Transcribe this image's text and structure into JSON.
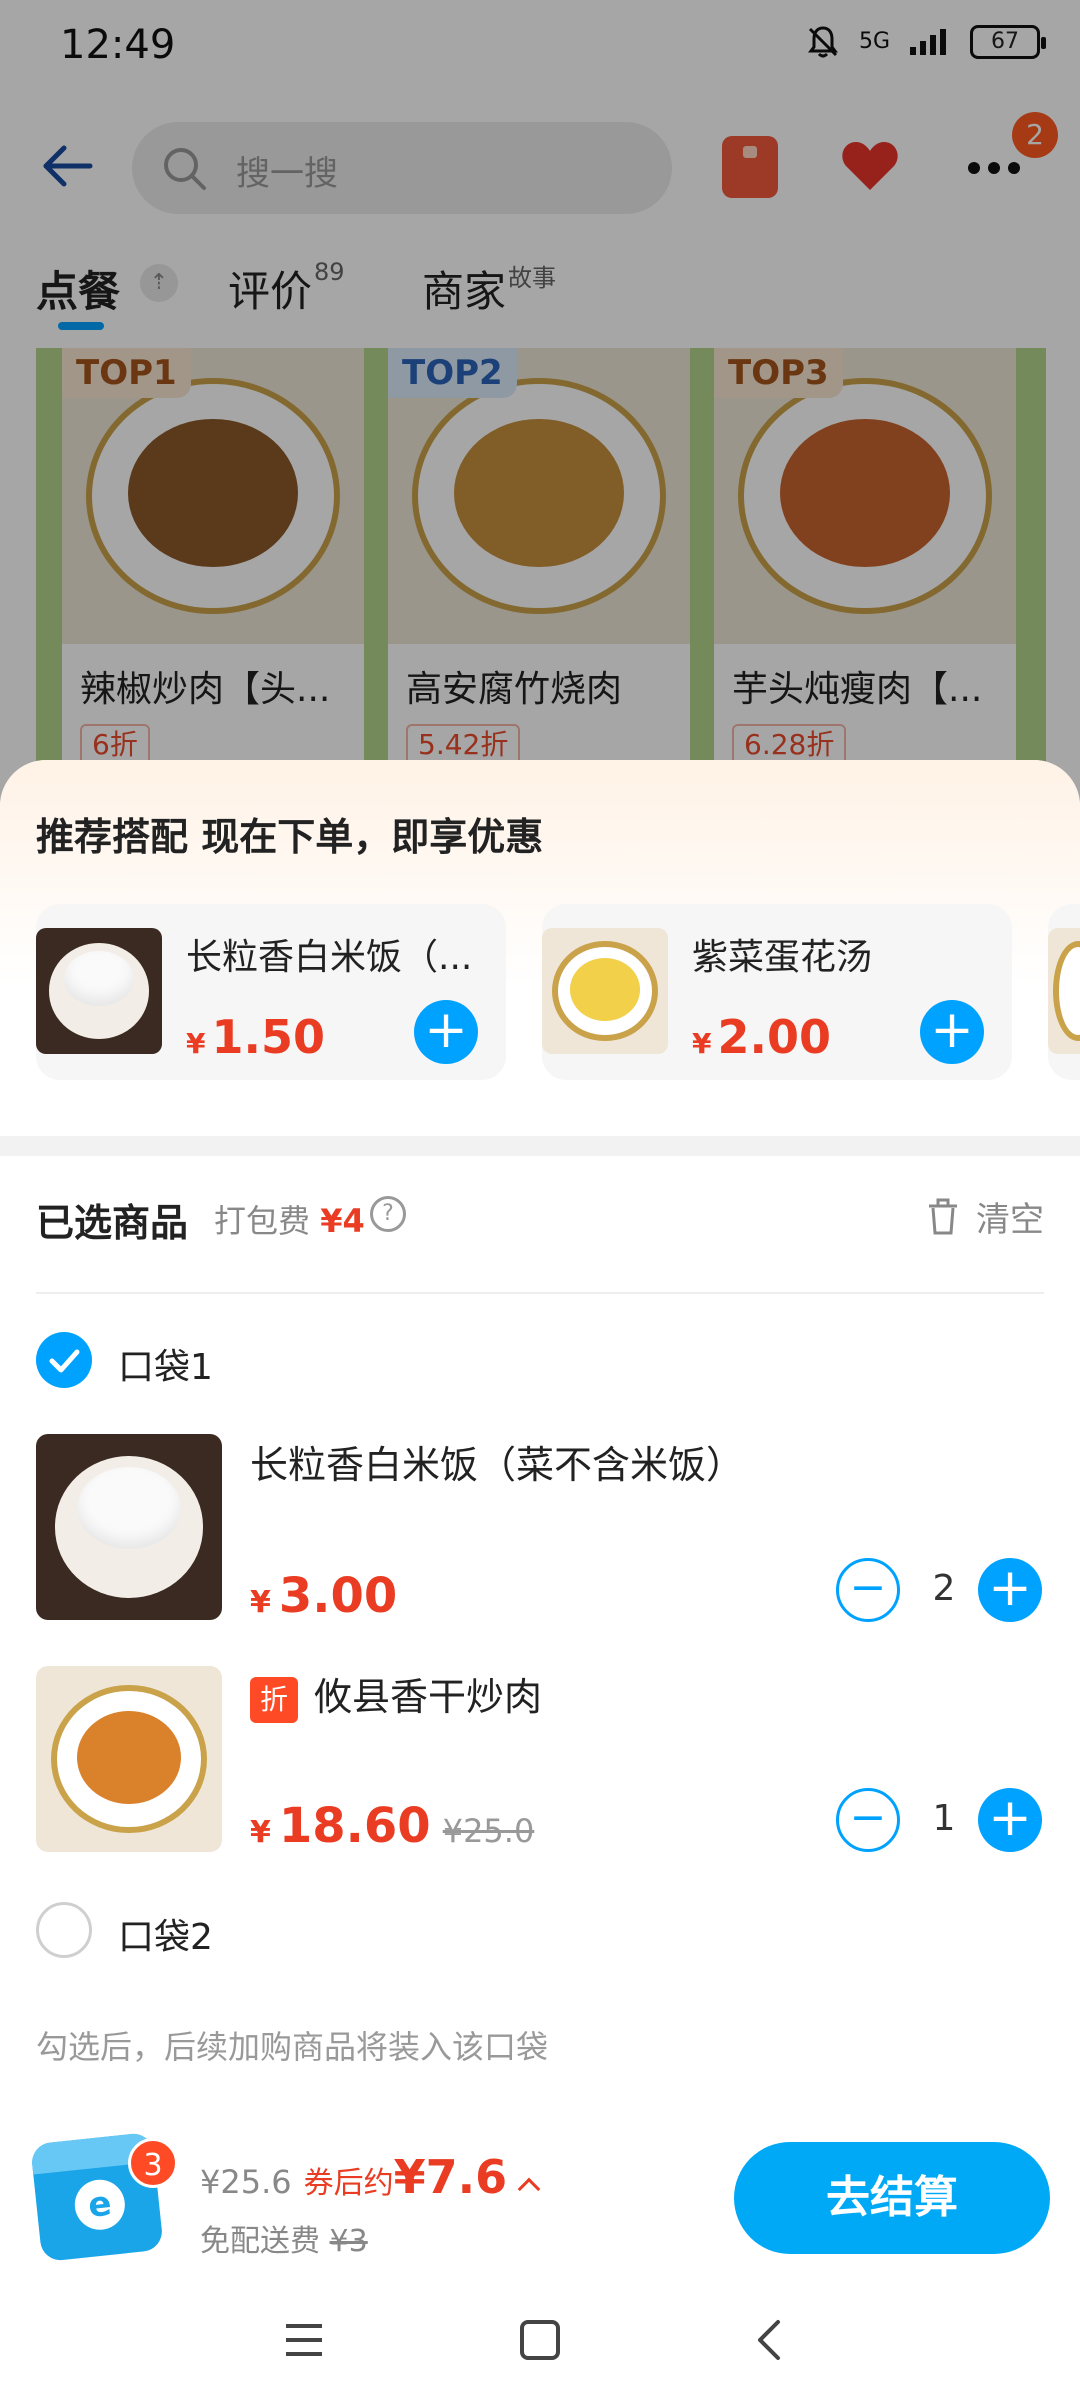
{
  "status_bar": {
    "time": "12:49",
    "signal": "5G",
    "battery": "67"
  },
  "header": {
    "search_placeholder": "搜一搜",
    "more_badge": "2"
  },
  "tabs": [
    {
      "label": "点餐",
      "sup": ""
    },
    {
      "label": "评价",
      "sup": "89"
    },
    {
      "label": "商家",
      "sup": "故事"
    }
  ],
  "top_list": [
    {
      "tag": "TOP1",
      "name": "辣椒炒肉【头...",
      "discount": "6折"
    },
    {
      "tag": "TOP2",
      "name": "高安腐竹烧肉",
      "discount": "5.42折"
    },
    {
      "tag": "TOP3",
      "name": "芋头炖瘦肉【...",
      "discount": "6.28折"
    }
  ],
  "recommend": {
    "title": "推荐搭配  现在下单，即享优惠",
    "items": [
      {
        "name": "长粒香白米饭（...",
        "currency": "¥",
        "price": "1.50"
      },
      {
        "name": "紫菜蛋花汤",
        "currency": "¥",
        "price": "2.00"
      }
    ]
  },
  "selected": {
    "title": "已选商品",
    "pack_fee_label": "打包费",
    "pack_fee": "¥4",
    "help": "?",
    "clear_label": "清空"
  },
  "bags": [
    {
      "label": "口袋1",
      "checked": true,
      "items": [
        {
          "name": "长粒香白米饭（菜不含米饭）",
          "currency": "¥",
          "price": "3.00",
          "original": "",
          "discount_tag": "",
          "qty": "2"
        },
        {
          "name": "攸县香干炒肉",
          "currency": "¥",
          "price": "18.60",
          "original": "¥25.0",
          "discount_tag": "折",
          "qty": "1"
        }
      ]
    },
    {
      "label": "口袋2",
      "checked": false,
      "items": []
    }
  ],
  "hint": "勾选后，后续加购商品将装入该口袋",
  "cart": {
    "badge": "3",
    "original_total": "¥25.6",
    "after_coupon_label": "券后约",
    "after_coupon_price": "¥7.6",
    "free_delivery_label": "免配送费",
    "delivery_original": "¥3",
    "checkout_label": "去结算"
  },
  "colors": {
    "accent": "#00a2ff",
    "price": "#ea3c23",
    "badge": "#ff4a26"
  },
  "icons": {
    "back": "back-arrow-icon",
    "search": "search-icon",
    "heart": "heart-icon",
    "more": "more-icon",
    "trash": "trash-icon",
    "check": "check-icon",
    "plus": "plus-icon",
    "minus": "minus-icon",
    "nav_menu": "menu-icon",
    "nav_home": "home-icon",
    "nav_back": "back-icon"
  }
}
